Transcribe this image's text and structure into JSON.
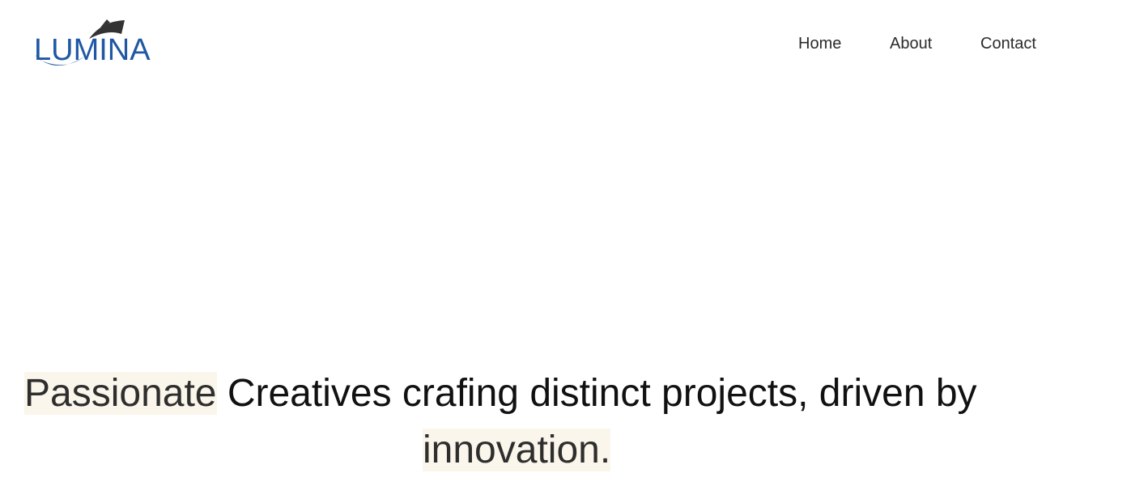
{
  "brand": {
    "logo_text": "LUMINA",
    "logo_icon": "sail-wave-logo",
    "colors": {
      "text_blue": "#1f57a4",
      "sail_dark": "#333333",
      "wave_blue": "#1f57a4"
    }
  },
  "nav": {
    "items": [
      {
        "label": "Home"
      },
      {
        "label": "About"
      },
      {
        "label": "Contact"
      }
    ]
  },
  "hero": {
    "highlight_word": "Passionate",
    "line1_rest": " Creatives crafing distinct projects, driven by",
    "line2_highlight": "innovation.",
    "highlight_color": "#fbf6eb"
  }
}
